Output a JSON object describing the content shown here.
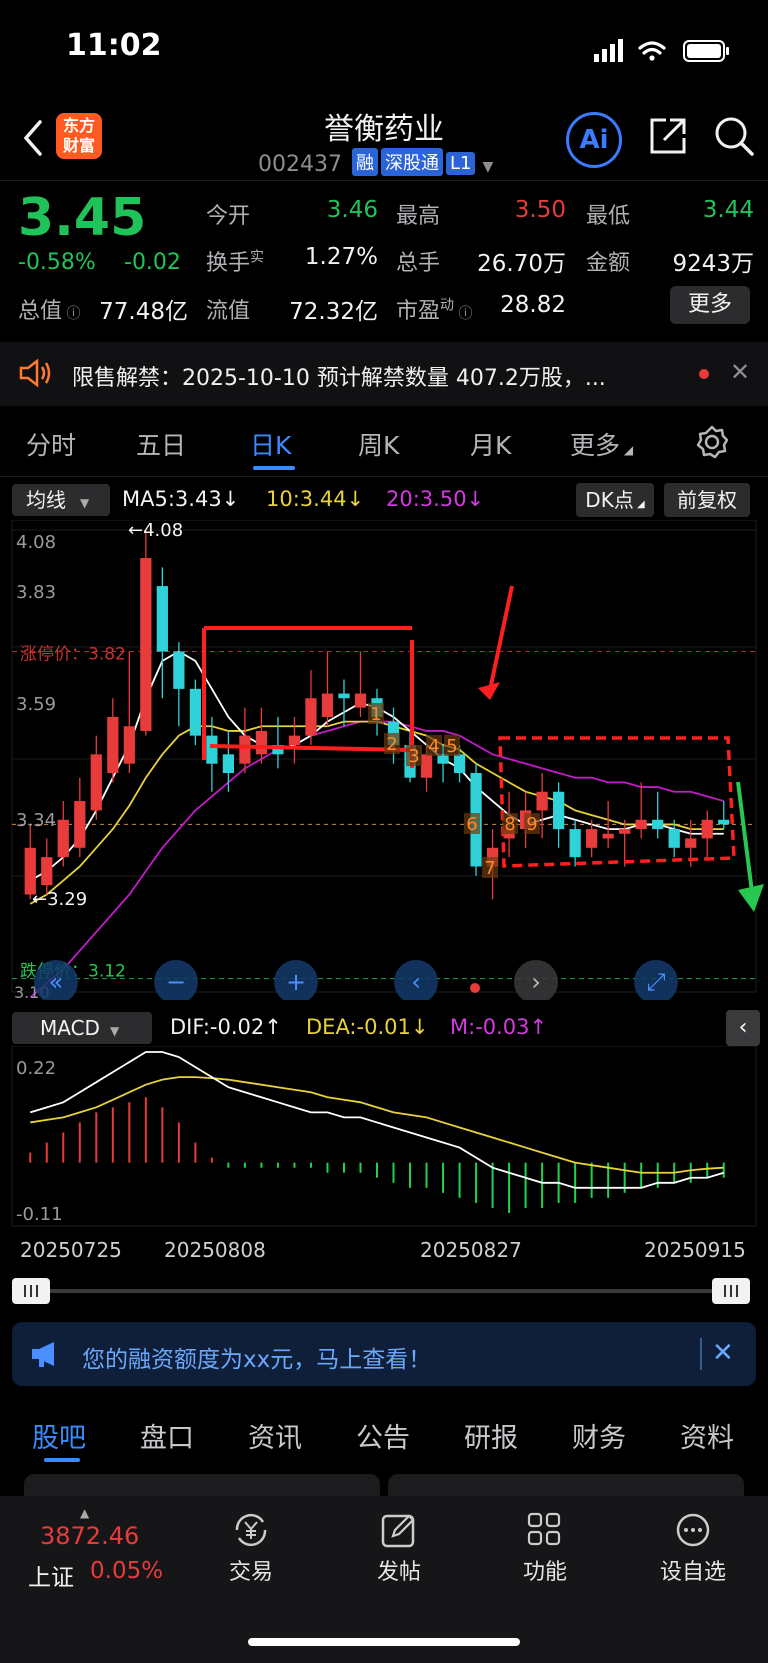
{
  "status_bar": {
    "time": "11:02"
  },
  "header": {
    "stock_name": "誉衡药业",
    "stock_code": "002437",
    "tags": [
      "融",
      "深股通",
      "L1"
    ],
    "logo_text": "东方财富",
    "ai_label": "Ai"
  },
  "quote": {
    "price": "3.45",
    "change_pct": "-0.58%",
    "change_abs": "-0.02",
    "fields": {
      "open_label": "今开",
      "open": "3.46",
      "high_label": "最高",
      "high": "3.50",
      "low_label": "最低",
      "low": "3.44",
      "turnover_label": "换手",
      "turnover_sup": "实",
      "turnover": "1.27%",
      "volume_label": "总手",
      "volume": "26.70万",
      "amount_label": "金额",
      "amount": "9243万",
      "mktcap_label": "总值",
      "mktcap": "77.48亿",
      "float_label": "流值",
      "float": "72.32亿",
      "pe_label": "市盈",
      "pe_sup": "动",
      "pe": "28.82"
    },
    "more_label": "更多"
  },
  "notice": {
    "text": "限售解禁：2025-10-10 预计解禁数量 407.2万股，..."
  },
  "period_tabs": [
    "分时",
    "五日",
    "日K",
    "周K",
    "月K",
    "更多"
  ],
  "active_period": "日K",
  "indicators": {
    "ma_select": "均线",
    "ma5": "MA5:3.43↓",
    "ma10": "10:3.44↓",
    "ma20": "20:3.50↓",
    "dk_label": "DK点",
    "fq_label": "前复权"
  },
  "kline": {
    "price_labels": [
      "4.08",
      "3.83",
      "3.59",
      "3.34",
      "3.10"
    ],
    "max_marker": "4.08",
    "min_marker": "3.29",
    "limit_up_label": "涨停价：",
    "limit_up": "3.82",
    "limit_down_label": "跌停价：",
    "limit_down": "3.12",
    "count_labels": [
      "1",
      "2",
      "3",
      "4",
      "5",
      "6",
      "7",
      "8",
      "9"
    ]
  },
  "macd": {
    "select": "MACD",
    "dif": "DIF:-0.02↑",
    "dea": "DEA:-0.01↓",
    "m": "M:-0.03↑",
    "top_label": "0.22",
    "bottom_label": "-0.11"
  },
  "dates": [
    "20250725",
    "20250808",
    "20250827",
    "20250915"
  ],
  "banner": {
    "text": "您的融资额度为xx元，马上查看！"
  },
  "bottom_tabs": [
    "股吧",
    "盘口",
    "资讯",
    "公告",
    "研报",
    "财务",
    "资料"
  ],
  "active_bottom_tab": "股吧",
  "bottom_nav": {
    "index_value": "3872.46",
    "index_name": "上证",
    "index_pct": "0.05%",
    "items": [
      "交易",
      "发帖",
      "功能",
      "设自选"
    ]
  },
  "colors": {
    "up": "#e83b3b",
    "down": "#2fd2d8",
    "ma5": "#ffffff",
    "ma10": "#e8d23a",
    "ma20": "#c21bc9",
    "accent": "#3a8bff"
  },
  "chart_data": {
    "type": "candlestick",
    "ylim": [
      3.1,
      4.08
    ],
    "candles": [
      {
        "o": 3.3,
        "c": 3.4,
        "h": 3.45,
        "l": 3.29
      },
      {
        "o": 3.32,
        "c": 3.38,
        "h": 3.42,
        "l": 3.3
      },
      {
        "o": 3.38,
        "c": 3.46,
        "h": 3.5,
        "l": 3.36
      },
      {
        "o": 3.4,
        "c": 3.5,
        "h": 3.55,
        "l": 3.38
      },
      {
        "o": 3.48,
        "c": 3.6,
        "h": 3.64,
        "l": 3.46
      },
      {
        "o": 3.56,
        "c": 3.68,
        "h": 3.72,
        "l": 3.54
      },
      {
        "o": 3.58,
        "c": 3.66,
        "h": 3.82,
        "l": 3.56
      },
      {
        "o": 3.65,
        "c": 4.02,
        "h": 4.08,
        "l": 3.64
      },
      {
        "o": 3.96,
        "c": 3.82,
        "h": 4.0,
        "l": 3.72
      },
      {
        "o": 3.82,
        "c": 3.74,
        "h": 3.84,
        "l": 3.66
      },
      {
        "o": 3.74,
        "c": 3.64,
        "h": 3.76,
        "l": 3.62
      },
      {
        "o": 3.64,
        "c": 3.58,
        "h": 3.68,
        "l": 3.52
      },
      {
        "o": 3.6,
        "c": 3.56,
        "h": 3.65,
        "l": 3.52
      },
      {
        "o": 3.58,
        "c": 3.64,
        "h": 3.7,
        "l": 3.56
      },
      {
        "o": 3.6,
        "c": 3.65,
        "h": 3.7,
        "l": 3.58
      },
      {
        "o": 3.62,
        "c": 3.6,
        "h": 3.68,
        "l": 3.57
      },
      {
        "o": 3.62,
        "c": 3.64,
        "h": 3.68,
        "l": 3.58
      },
      {
        "o": 3.64,
        "c": 3.72,
        "h": 3.78,
        "l": 3.62
      },
      {
        "o": 3.68,
        "c": 3.73,
        "h": 3.82,
        "l": 3.66
      },
      {
        "o": 3.73,
        "c": 3.72,
        "h": 3.76,
        "l": 3.66
      },
      {
        "o": 3.7,
        "c": 3.73,
        "h": 3.82,
        "l": 3.68
      },
      {
        "o": 3.72,
        "c": 3.68,
        "h": 3.74,
        "l": 3.64
      },
      {
        "o": 3.67,
        "c": 3.62,
        "h": 3.7,
        "l": 3.58
      },
      {
        "o": 3.62,
        "c": 3.55,
        "h": 3.65,
        "l": 3.54
      },
      {
        "o": 3.55,
        "c": 3.6,
        "h": 3.62,
        "l": 3.52
      },
      {
        "o": 3.6,
        "c": 3.58,
        "h": 3.62,
        "l": 3.54
      },
      {
        "o": 3.6,
        "c": 3.56,
        "h": 3.62,
        "l": 3.54
      },
      {
        "o": 3.56,
        "c": 3.36,
        "h": 3.58,
        "l": 3.34
      },
      {
        "o": 3.36,
        "c": 3.4,
        "h": 3.44,
        "l": 3.29
      },
      {
        "o": 3.42,
        "c": 3.44,
        "h": 3.52,
        "l": 3.38
      },
      {
        "o": 3.44,
        "c": 3.48,
        "h": 3.52,
        "l": 3.4
      },
      {
        "o": 3.48,
        "c": 3.52,
        "h": 3.56,
        "l": 3.42
      },
      {
        "o": 3.52,
        "c": 3.44,
        "h": 3.54,
        "l": 3.4
      },
      {
        "o": 3.44,
        "c": 3.38,
        "h": 3.46,
        "l": 3.36
      },
      {
        "o": 3.4,
        "c": 3.44,
        "h": 3.46,
        "l": 3.38
      },
      {
        "o": 3.42,
        "c": 3.43,
        "h": 3.5,
        "l": 3.4
      },
      {
        "o": 3.43,
        "c": 3.44,
        "h": 3.46,
        "l": 3.36
      },
      {
        "o": 3.44,
        "c": 3.46,
        "h": 3.54,
        "l": 3.42
      },
      {
        "o": 3.46,
        "c": 3.44,
        "h": 3.52,
        "l": 3.42
      },
      {
        "o": 3.44,
        "c": 3.4,
        "h": 3.46,
        "l": 3.38
      },
      {
        "o": 3.4,
        "c": 3.42,
        "h": 3.46,
        "l": 3.36
      },
      {
        "o": 3.42,
        "c": 3.46,
        "h": 3.48,
        "l": 3.38
      },
      {
        "o": 3.46,
        "c": 3.45,
        "h": 3.5,
        "l": 3.44
      }
    ],
    "ma5": [
      3.33,
      3.35,
      3.38,
      3.42,
      3.48,
      3.55,
      3.62,
      3.72,
      3.8,
      3.82,
      3.8,
      3.74,
      3.68,
      3.64,
      3.62,
      3.61,
      3.62,
      3.64,
      3.67,
      3.69,
      3.71,
      3.7,
      3.68,
      3.65,
      3.62,
      3.59,
      3.57,
      3.53,
      3.5,
      3.47,
      3.45,
      3.46,
      3.47,
      3.46,
      3.45,
      3.44,
      3.44,
      3.45,
      3.45,
      3.44,
      3.43,
      3.43,
      3.43
    ],
    "ma10": [
      3.28,
      3.3,
      3.33,
      3.36,
      3.4,
      3.44,
      3.49,
      3.55,
      3.6,
      3.64,
      3.66,
      3.66,
      3.65,
      3.65,
      3.66,
      3.66,
      3.66,
      3.66,
      3.66,
      3.67,
      3.67,
      3.67,
      3.66,
      3.65,
      3.64,
      3.62,
      3.61,
      3.58,
      3.56,
      3.54,
      3.52,
      3.51,
      3.5,
      3.48,
      3.47,
      3.46,
      3.45,
      3.45,
      3.45,
      3.45,
      3.44,
      3.44,
      3.44
    ],
    "ma20": [
      3.08,
      3.11,
      3.14,
      3.18,
      3.22,
      3.26,
      3.3,
      3.35,
      3.4,
      3.44,
      3.48,
      3.51,
      3.54,
      3.57,
      3.59,
      3.61,
      3.62,
      3.64,
      3.65,
      3.66,
      3.67,
      3.67,
      3.67,
      3.66,
      3.65,
      3.65,
      3.64,
      3.62,
      3.6,
      3.59,
      3.58,
      3.57,
      3.56,
      3.55,
      3.55,
      3.54,
      3.54,
      3.53,
      3.53,
      3.52,
      3.52,
      3.51,
      3.5
    ],
    "macd_ylim": [
      -0.11,
      0.22
    ],
    "dif": [
      0.1,
      0.11,
      0.12,
      0.14,
      0.16,
      0.18,
      0.2,
      0.22,
      0.22,
      0.21,
      0.19,
      0.17,
      0.15,
      0.14,
      0.13,
      0.12,
      0.11,
      0.1,
      0.1,
      0.09,
      0.09,
      0.08,
      0.07,
      0.06,
      0.05,
      0.04,
      0.03,
      0.01,
      -0.01,
      -0.02,
      -0.03,
      -0.04,
      -0.04,
      -0.05,
      -0.05,
      -0.05,
      -0.05,
      -0.05,
      -0.04,
      -0.04,
      -0.03,
      -0.03,
      -0.02
    ],
    "dea": [
      0.08,
      0.085,
      0.09,
      0.1,
      0.11,
      0.125,
      0.14,
      0.155,
      0.165,
      0.17,
      0.17,
      0.168,
      0.165,
      0.16,
      0.155,
      0.15,
      0.145,
      0.14,
      0.13,
      0.125,
      0.12,
      0.11,
      0.1,
      0.095,
      0.09,
      0.08,
      0.07,
      0.06,
      0.05,
      0.04,
      0.03,
      0.02,
      0.01,
      0.0,
      -0.005,
      -0.01,
      -0.015,
      -0.02,
      -0.02,
      -0.02,
      -0.015,
      -0.012,
      -0.01
    ],
    "hist": [
      0.02,
      0.04,
      0.06,
      0.08,
      0.1,
      0.11,
      0.12,
      0.13,
      0.11,
      0.08,
      0.04,
      0.01,
      -0.01,
      -0.01,
      -0.01,
      -0.01,
      -0.01,
      -0.01,
      -0.02,
      -0.02,
      -0.02,
      -0.03,
      -0.04,
      -0.05,
      -0.05,
      -0.06,
      -0.07,
      -0.08,
      -0.09,
      -0.1,
      -0.09,
      -0.09,
      -0.08,
      -0.08,
      -0.07,
      -0.07,
      -0.06,
      -0.05,
      -0.05,
      -0.04,
      -0.04,
      -0.03,
      -0.03
    ]
  }
}
